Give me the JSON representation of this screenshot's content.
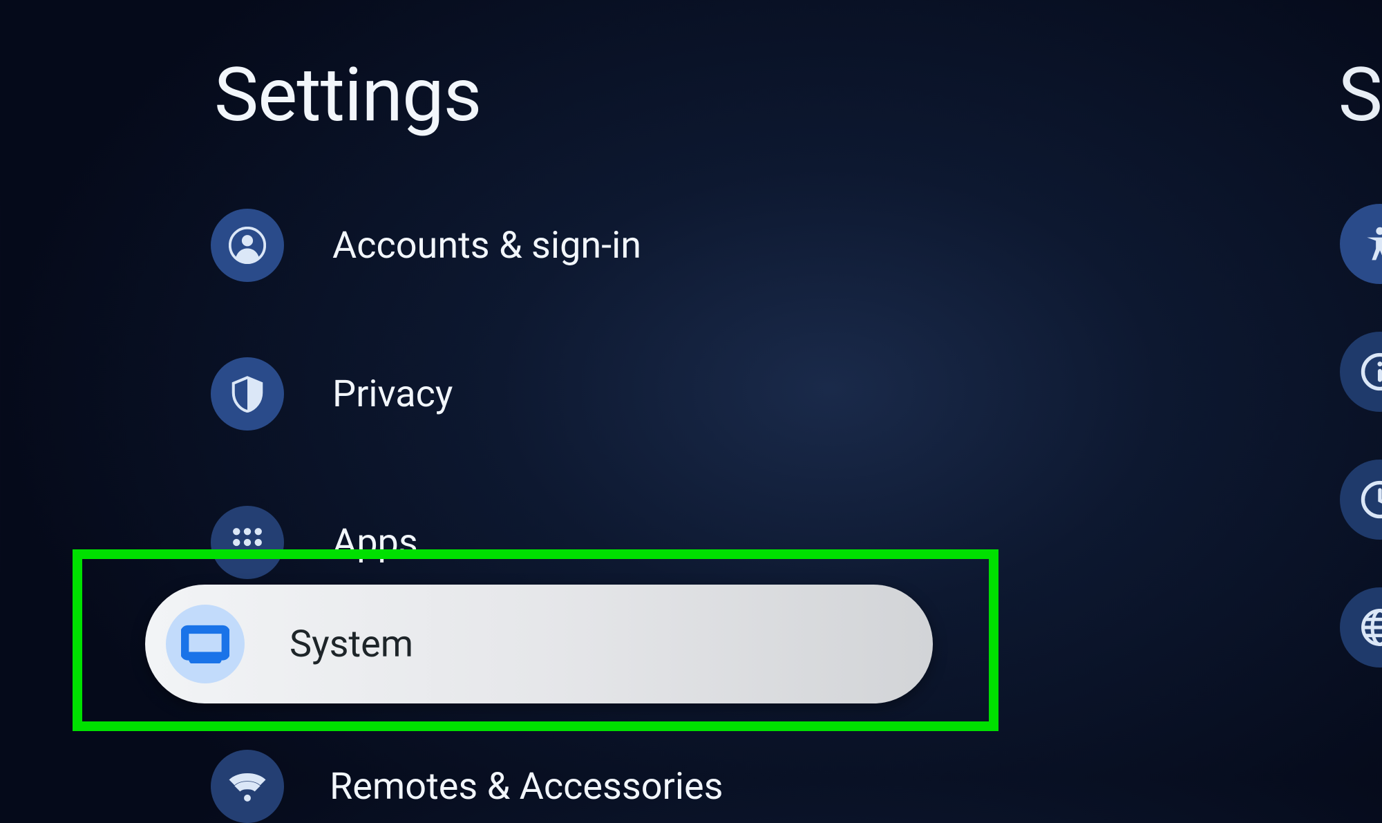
{
  "page": {
    "title": "Settings",
    "right_panel_title_partial": "Sy"
  },
  "settings": {
    "items": [
      {
        "id": "accounts",
        "label": "Accounts & sign-in",
        "icon": "account-circle"
      },
      {
        "id": "privacy",
        "label": "Privacy",
        "icon": "shield"
      },
      {
        "id": "apps",
        "label": "Apps",
        "icon": "apps-grid"
      },
      {
        "id": "system",
        "label": "System",
        "icon": "tv",
        "focused": true
      },
      {
        "id": "remotes",
        "label": "Remotes & Accessories",
        "icon": "wifi",
        "partial": true
      }
    ]
  },
  "right_column": {
    "items": [
      {
        "id": "accessibility",
        "icon": "accessibility"
      },
      {
        "id": "info",
        "icon": "info"
      },
      {
        "id": "clock",
        "icon": "clock"
      },
      {
        "id": "language",
        "icon": "globe"
      }
    ]
  },
  "colors": {
    "accent_blue": "#1a73e8",
    "bg_dark": "#0d1830",
    "item_circle": "#2a4b8a",
    "highlight_green": "#00e000",
    "focused_bg": "#eaeaee",
    "focused_icon_bg": "#c2dbfb"
  }
}
